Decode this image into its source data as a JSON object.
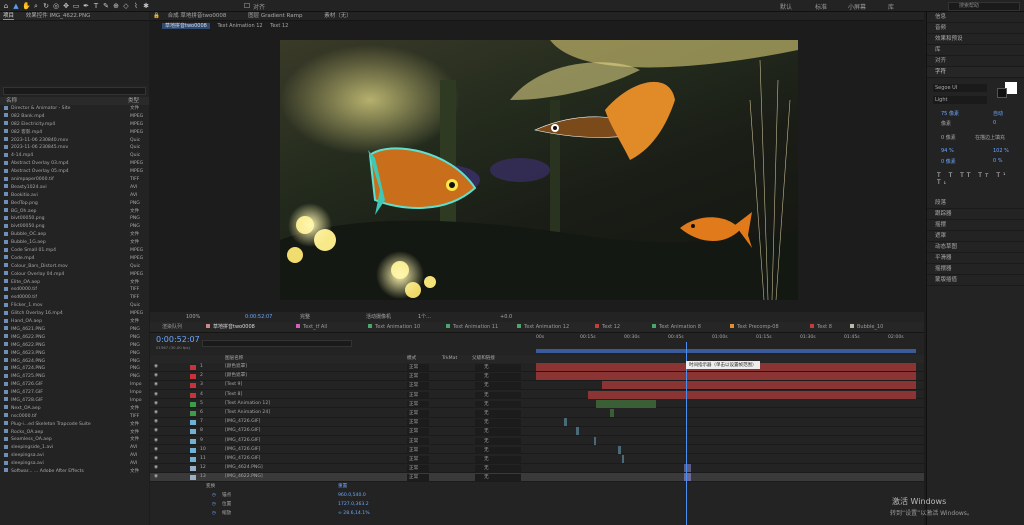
{
  "toolbar": {
    "snap_label": "对齐",
    "workspaces": [
      "默认",
      "标准",
      "小屏幕",
      "库"
    ],
    "search_placeholder": "搜索帮助"
  },
  "project": {
    "tab": "项目",
    "effects_tab": "效果控件 IMG_4622.PNG",
    "col_name": "名称",
    "col_type": "类型",
    "files": [
      {
        "name": "Director & Animator - Site",
        "type": "文件"
      },
      {
        "name": "082 Bank.mp4",
        "type": "MPEG"
      },
      {
        "name": "082 Electricity.mp4",
        "type": "MPEG"
      },
      {
        "name": "082 客影.mp4",
        "type": "MPEG"
      },
      {
        "name": "2023-11-06 230840.mov",
        "type": "Quic"
      },
      {
        "name": "2023-11-06 230845.mov",
        "type": "Quic"
      },
      {
        "name": "4-14.mp4",
        "type": "Quic"
      },
      {
        "name": "Abstract Overlay 03.mp4",
        "type": "MPEG"
      },
      {
        "name": "Abstract Overlay 05.mp4",
        "type": "MPEG"
      },
      {
        "name": "animpaper0000.tif",
        "type": "TIFF"
      },
      {
        "name": "Beasty1024.avi",
        "type": "AVI"
      },
      {
        "name": "Bookitio.avi",
        "type": "AVI"
      },
      {
        "name": "BedTop.png",
        "type": "PNG"
      },
      {
        "name": "BG_Oh.aep",
        "type": "文件"
      },
      {
        "name": "bivt00050.png",
        "type": "PNG"
      },
      {
        "name": "bivt00050.png",
        "type": "PNG"
      },
      {
        "name": "Bubble_OC.aep",
        "type": "文件"
      },
      {
        "name": "Bubble_1G.aep",
        "type": "文件"
      },
      {
        "name": "Code Small 01.mp4",
        "type": "MPEG"
      },
      {
        "name": "Code.mp4",
        "type": "MPEG"
      },
      {
        "name": "Colour_Bars_Distort.mov",
        "type": "Quic"
      },
      {
        "name": "Colour Overlay 04.mp4",
        "type": "MPEG"
      },
      {
        "name": "Elite_OA.aep",
        "type": "文件"
      },
      {
        "name": "esd0000.tif",
        "type": "TIFF"
      },
      {
        "name": "esd0000.tif",
        "type": "TIFF"
      },
      {
        "name": "Flicker_1.mov",
        "type": "Quic"
      },
      {
        "name": "Glitch Overlay 16.mp4",
        "type": "MPEG"
      },
      {
        "name": "Hand_OA.aep",
        "type": "文件"
      },
      {
        "name": "IMG_4621.PNG",
        "type": "PNG"
      },
      {
        "name": "IMG_4622.PNG",
        "type": "PNG"
      },
      {
        "name": "IMG_4622.PNG",
        "type": "PNG"
      },
      {
        "name": "IMG_4623.PNG",
        "type": "PNG"
      },
      {
        "name": "IMG_4624.PNG",
        "type": "PNG"
      },
      {
        "name": "IMG_4724.PNG",
        "type": "PNG"
      },
      {
        "name": "IMG_4725.PNG",
        "type": "PNG"
      },
      {
        "name": "IMG_4726.GIF",
        "type": "Impo"
      },
      {
        "name": "IMG_4727.GIF",
        "type": "Impo"
      },
      {
        "name": "IMG_4728.GIF",
        "type": "Impo"
      },
      {
        "name": "Next_OA.aep",
        "type": "文件"
      },
      {
        "name": "nsc0000.tif",
        "type": "TIFF"
      },
      {
        "name": "Plug-i...ed Skeleton Trapcode Suite",
        "type": "文件"
      },
      {
        "name": "Rocks_OA.aep",
        "type": "文件"
      },
      {
        "name": "Seamless_OA.aep",
        "type": "文件"
      },
      {
        "name": "sleepingside_1.avi",
        "type": "AVI"
      },
      {
        "name": "sleepingsa.avi",
        "type": "AVI"
      },
      {
        "name": "sleepingsa.avi",
        "type": "AVI"
      },
      {
        "name": "Softwar... ... Adobe After Effects",
        "type": "文件"
      }
    ]
  },
  "viewer_tabs": {
    "comp_label": "合成 草地拼音two0008",
    "layer_label": "图层 Gradient Ramp",
    "footage_label": "素材（无）",
    "active": "草地拼音two0008",
    "sub": [
      "Text Animation 12",
      "Text 12"
    ]
  },
  "viewer_bar": {
    "zoom": "100%",
    "timecode": "0:00:52:07",
    "view": "完整",
    "camera": "活动摄像机",
    "views": "1个...",
    "offset": "+0.0"
  },
  "right_panel": {
    "items_top": [
      "信息",
      "音频",
      "效果和预设",
      "库",
      "对齐"
    ],
    "char_title": "字符",
    "font": "Segoe UI",
    "style": "Light",
    "size": "75 像素",
    "leading": "自动",
    "kerning": "像素",
    "tracking": "0",
    "indent": "0 像素",
    "stroke": "在描边上填充",
    "vscale": "94 %",
    "hscale": "102 %",
    "baseline": "0 像素",
    "tsume": "0 %",
    "items_bottom": [
      "段落",
      "跟踪器",
      "摇摆",
      "遮罩",
      "动态草图",
      "平滑器",
      "摇摆器",
      "蒙版插值"
    ]
  },
  "timeline": {
    "timecode": "0:00:52:07",
    "frames": "01567 (30.00 fps)",
    "search_placeholder": "",
    "tabs": [
      {
        "label": "渲染队列",
        "color": ""
      },
      {
        "label": "草地拼音two0008",
        "color": "#c88"
      },
      {
        "label": "Text_tf All",
        "color": "#d35fb7"
      },
      {
        "label": "Text Animation 10",
        "color": "#4aa66e"
      },
      {
        "label": "Text Animation 11",
        "color": "#4aa66e"
      },
      {
        "label": "Text Animation 12",
        "color": "#4aa66e"
      },
      {
        "label": "Text 12",
        "color": "#c83b3b"
      },
      {
        "label": "Text Animation 8",
        "color": "#4aa66e"
      },
      {
        "label": "Text Precomp-08",
        "color": "#e09030"
      },
      {
        "label": "Text 8",
        "color": "#c83b3b"
      },
      {
        "label": "Bubble_10",
        "color": "#bba"
      }
    ],
    "cols": {
      "name": "图层名称",
      "mode": "模式",
      "trkmat": "TrkMat",
      "parent": "父级和链接"
    },
    "ruler": [
      "00s",
      "00:15s",
      "00:30s",
      "00:45s",
      "01:00s",
      "01:15s",
      "01:30s",
      "01:45s",
      "02:00s"
    ],
    "tooltip": "时间指示器（单击以设置帧范围）",
    "layers": [
      {
        "num": "1",
        "name": "[颜色遮罩]",
        "color": "#c8323a",
        "mode": "正常",
        "parent": "无"
      },
      {
        "num": "2",
        "name": "[颜色遮罩]",
        "color": "#c8323a",
        "mode": "正常",
        "parent": "无"
      },
      {
        "num": "3",
        "name": "[Text 9]",
        "color": "#c8323a",
        "mode": "正常",
        "parent": "无"
      },
      {
        "num": "4",
        "name": "[Text 8]",
        "color": "#c8323a",
        "mode": "正常",
        "parent": "无"
      },
      {
        "num": "5",
        "name": "[Text Animation 12]",
        "color": "#3d9c4a",
        "mode": "正常",
        "parent": "无"
      },
      {
        "num": "6",
        "name": "[Text Animation 24]",
        "color": "#3d9c4a",
        "mode": "正常",
        "parent": "无"
      },
      {
        "num": "7",
        "name": "[IMG_4726.GIF]",
        "color": "#6fb2d6",
        "mode": "正常",
        "parent": "无"
      },
      {
        "num": "8",
        "name": "[IMG_4726.GIF]",
        "color": "#6fb2d6",
        "mode": "正常",
        "parent": "无"
      },
      {
        "num": "9",
        "name": "[IMG_4726.GIF]",
        "color": "#6fb2d6",
        "mode": "正常",
        "parent": "无"
      },
      {
        "num": "10",
        "name": "[IMG_4726.GIF]",
        "color": "#6fb2d6",
        "mode": "正常",
        "parent": "无"
      },
      {
        "num": "11",
        "name": "[IMG_4726.GIF]",
        "color": "#6fb2d6",
        "mode": "正常",
        "parent": "无"
      },
      {
        "num": "12",
        "name": "[IMG_4624.PNG]",
        "color": "#9ab0c8",
        "mode": "正常",
        "parent": "无"
      },
      {
        "num": "13",
        "name": "[IMG_4622.PNG]",
        "color": "#9ab0c8",
        "mode": "正常",
        "parent": "无"
      }
    ],
    "transform": {
      "label": "变换",
      "reset": "重置",
      "props": [
        {
          "name": "锚点",
          "value": "960.0,540.0"
        },
        {
          "name": "位置",
          "value": "1727.0,363.2"
        },
        {
          "name": "缩放",
          "value": "∞ 28.6,14.1%"
        }
      ]
    }
  },
  "watermark": {
    "line1": "激活 Windows",
    "line2": "转到“设置”以激活 Windows。"
  }
}
